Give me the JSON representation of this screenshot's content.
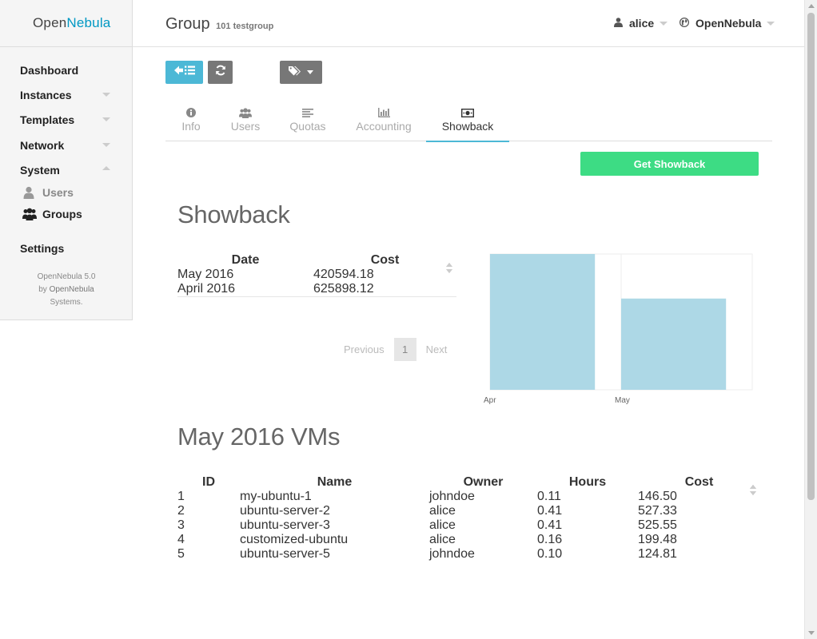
{
  "sidebar": {
    "logo_part1": "Open",
    "logo_part2": "Nebula",
    "items": [
      {
        "label": "Dashboard"
      },
      {
        "label": "Instances"
      },
      {
        "label": "Templates"
      },
      {
        "label": "Network"
      },
      {
        "label": "System"
      },
      {
        "label": "Settings"
      }
    ],
    "sub_items": [
      {
        "label": "Users",
        "icon": "user-icon"
      },
      {
        "label": "Groups",
        "icon": "users-icon"
      }
    ],
    "version_line1": "OpenNebula 5.0",
    "version_by": "by",
    "version_vendor": "OpenNebula",
    "version_line3": "Systems."
  },
  "header": {
    "title": "Group",
    "subtitle": "101 testgroup",
    "user": "alice",
    "zone": "OpenNebula"
  },
  "tabs": [
    {
      "label": "Info",
      "icon": "info-icon"
    },
    {
      "label": "Users",
      "icon": "users-icon"
    },
    {
      "label": "Quotas",
      "icon": "align-left-icon"
    },
    {
      "label": "Accounting",
      "icon": "bar-chart-icon"
    },
    {
      "label": "Showback",
      "icon": "money-icon",
      "active": true
    }
  ],
  "get_showback_label": "Get Showback",
  "showback": {
    "title": "Showback",
    "columns": [
      "Date",
      "Cost"
    ],
    "rows": [
      {
        "date": "May 2016",
        "cost": "420594.18"
      },
      {
        "date": "April 2016",
        "cost": "625898.12"
      }
    ],
    "pager": {
      "previous": "Previous",
      "page": "1",
      "next": "Next"
    }
  },
  "chart_data": {
    "type": "bar",
    "categories": [
      "Apr",
      "May"
    ],
    "values": [
      625898.12,
      420594.18
    ],
    "ylim": [
      0,
      625898.12
    ],
    "color": "#add8e6",
    "grid": true,
    "xlabel": "",
    "ylabel": ""
  },
  "vms": {
    "title": "May 2016 VMs",
    "columns": [
      "ID",
      "Name",
      "Owner",
      "Hours",
      "Cost"
    ],
    "rows": [
      {
        "id": "1",
        "name": "my-ubuntu-1",
        "owner": "johndoe",
        "hours": "0.11",
        "cost": "146.50"
      },
      {
        "id": "2",
        "name": "ubuntu-server-2",
        "owner": "alice",
        "hours": "0.41",
        "cost": "527.33"
      },
      {
        "id": "3",
        "name": "ubuntu-server-3",
        "owner": "alice",
        "hours": "0.41",
        "cost": "525.55"
      },
      {
        "id": "4",
        "name": "customized-ubuntu",
        "owner": "alice",
        "hours": "0.16",
        "cost": "199.48"
      },
      {
        "id": "5",
        "name": "ubuntu-server-5",
        "owner": "johndoe",
        "hours": "0.10",
        "cost": "124.81"
      }
    ]
  },
  "colors": {
    "accent": "#4cb8d6",
    "brand": "#0098c3",
    "success": "#3ddc84",
    "bar": "#add8e6"
  }
}
